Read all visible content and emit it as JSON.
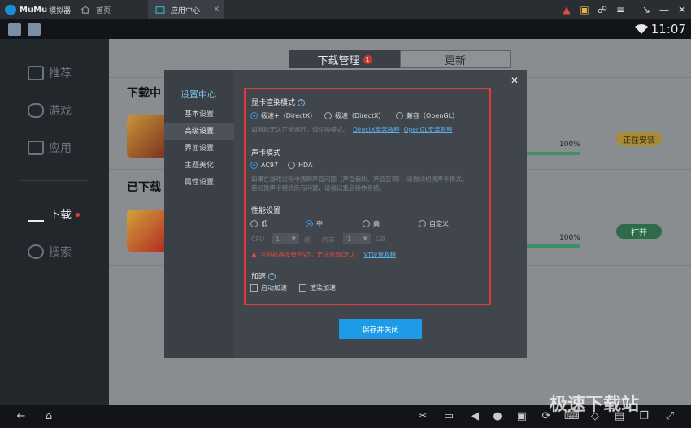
{
  "titlebar": {
    "app_name": "MuMu",
    "app_suffix": "模拟器",
    "tabs": [
      {
        "label": "首页",
        "close": ""
      },
      {
        "label": "应用中心",
        "close": "✕"
      }
    ]
  },
  "statusbar": {
    "time": "11:07"
  },
  "sidebar": {
    "items": [
      {
        "label": "推荐"
      },
      {
        "label": "游戏"
      },
      {
        "label": "应用"
      },
      {
        "label": "下载"
      },
      {
        "label": "搜索"
      }
    ]
  },
  "main": {
    "segment": {
      "download": "下载管理",
      "download_badge": "1",
      "update": "更新"
    },
    "sections": {
      "downloading": "下载中",
      "downloaded": "已下载"
    },
    "rows": [
      {
        "progress_text": "100%",
        "status": "正在安装"
      },
      {
        "progress_text": "100%",
        "status": "打开"
      }
    ]
  },
  "modal": {
    "title": "设置中心",
    "close": "✕",
    "menu": [
      "基本设置",
      "高级设置",
      "界面设置",
      "主题美化",
      "属性设置"
    ],
    "gpu": {
      "title": "显卡渲染模式",
      "options": [
        "极速+（DirectX）",
        "极速（DirectX）",
        "兼容（OpenGL）"
      ],
      "hint": "如游戏无法正常运行，请切换模式。",
      "link_dx": "DirectX安装教程",
      "link_gl": "OpenGL安装教程"
    },
    "sound": {
      "title": "声卡模式",
      "options": [
        "AC97",
        "HDA"
      ],
      "hint_1": "如果在游戏过程中遇到声音问题（声音偏快、声音变调），请尝试切换声卡模式。",
      "hint_2": "若切换声卡模式仍有问题，请尝试重启操作系统。"
    },
    "perf": {
      "title": "性能设置",
      "options": [
        "低",
        "中",
        "高",
        "自定义"
      ],
      "cpu_label": "CPU",
      "cpu_value": "1",
      "cpu_unit": "核",
      "mem_label": "内存",
      "mem_value": "1",
      "mem_unit": "GB",
      "warning": "当前机器没有开VT，无法修改CPU。",
      "vt_link": "VT设置教程"
    },
    "accel": {
      "title": "加速",
      "options": [
        "启动加速",
        "渲染加速"
      ]
    },
    "save": "保存并关闭"
  },
  "watermark": "极速下载站",
  "colors": {
    "accent": "#1e9be6",
    "highlight_frame": "#e03b3b",
    "warning": "#e14a40"
  }
}
